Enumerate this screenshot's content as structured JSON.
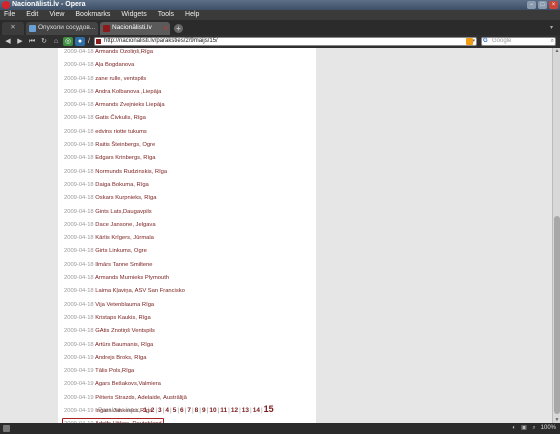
{
  "window": {
    "title": "Nacionālisti.lv - Opera",
    "controls": [
      "−",
      "□",
      "×"
    ]
  },
  "menubar": {
    "items": [
      "File",
      "Edit",
      "View",
      "Bookmarks",
      "Widgets",
      "Tools",
      "Help"
    ]
  },
  "tabs": {
    "panel_label": "✕",
    "items": [
      {
        "label": "Опухоли сосудов..."
      },
      {
        "label": "Nacionālisti.lv"
      }
    ],
    "new_tab": "+"
  },
  "navbar": {
    "address": "http://nacionalisti.lv/paraksties/2/9maijs/15/",
    "search_placeholder": "Google",
    "icons": [
      "back-icon",
      "forward-icon",
      "rewind-icon",
      "reload-icon",
      "home-icon",
      "turbo-icon",
      "unite-icon",
      "wand-icon",
      "rss-icon"
    ]
  },
  "signatures": [
    {
      "date": "2009-04-18",
      "name": "Armands Ozoliņš,Rīga"
    },
    {
      "date": "2009-04-18",
      "name": "Aļa Bogdanova"
    },
    {
      "date": "2009-04-18",
      "name": "zane rulle, ventspils"
    },
    {
      "date": "2009-04-18",
      "name": "Andra Kolbanova ,Liepāja"
    },
    {
      "date": "2009-04-18",
      "name": "Armands Zvejnieks Liepāja"
    },
    {
      "date": "2009-04-18",
      "name": "Gatis Čivkulis, Rīga"
    },
    {
      "date": "2009-04-18",
      "name": "edvins riotte tukums"
    },
    {
      "date": "2009-04-18",
      "name": "Raitis Šteinbergs, Ogre"
    },
    {
      "date": "2009-04-18",
      "name": "Edgars Krinbergs, Rīga"
    },
    {
      "date": "2009-04-18",
      "name": "Normunds Rudzinskis, Rīga"
    },
    {
      "date": "2009-04-18",
      "name": "Daiga Bokuma, Rīga"
    },
    {
      "date": "2009-04-18",
      "name": "Oskars Kurpnieks, Rīga"
    },
    {
      "date": "2009-04-18",
      "name": "Gints Lats,Daugavpils"
    },
    {
      "date": "2009-04-18",
      "name": "Dace Jansone, Jelgava"
    },
    {
      "date": "2009-04-18",
      "name": "Kārlis Krīgers, Jūrmala"
    },
    {
      "date": "2009-04-18",
      "name": "Girts Linkums, Ogre"
    },
    {
      "date": "2009-04-18",
      "name": "Ilmārs Tanne Smiltene"
    },
    {
      "date": "2009-04-18",
      "name": "Armands Murnieks Plymouth"
    },
    {
      "date": "2009-04-18",
      "name": "Laima Kļaviņa, ASV San Francisko"
    },
    {
      "date": "2009-04-18",
      "name": "Vija Vetenblauma Rīga"
    },
    {
      "date": "2009-04-18",
      "name": "Kristaps Kaukis, Rīga"
    },
    {
      "date": "2009-04-18",
      "name": "GAtis Znotiņš Ventspils"
    },
    {
      "date": "2009-04-18",
      "name": "Artūrs Baumanis, Rīga"
    },
    {
      "date": "2009-04-19",
      "name": "Andrejs Broks, Rīga"
    },
    {
      "date": "2009-04-19",
      "name": "Tālis Pols,Rīga"
    },
    {
      "date": "2009-04-19",
      "name": "Agars Bešakovs,Valmiera"
    },
    {
      "date": "2009-04-19",
      "name": "Pēteris Strazds, Adelaide, Austrālijā"
    },
    {
      "date": "2009-04-19",
      "name": "Ingars Jankevics,Rīga"
    },
    {
      "date": "2009-04-19",
      "name": "Adolfs Hitlers, Deutchland",
      "highlighted": true
    }
  ],
  "pagination": {
    "label": "Parakstu lapa:",
    "pages": [
      "1",
      "2",
      "3",
      "4",
      "5",
      "6",
      "7",
      "8",
      "9",
      "10",
      "11",
      "12",
      "13",
      "14"
    ],
    "current": "15"
  },
  "statusbar": {
    "zoom": "100%"
  },
  "colors": {
    "link": "#7a1c1c",
    "date": "#999999",
    "highlight_border": "#aa2222"
  }
}
